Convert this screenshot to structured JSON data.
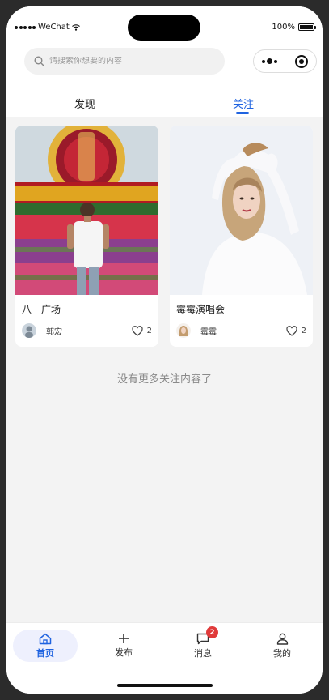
{
  "status_bar": {
    "carrier": "WeChat",
    "battery_text": "100%"
  },
  "search": {
    "placeholder": "请搜索你想要的内容"
  },
  "tabs": [
    {
      "label": "发现",
      "active": false
    },
    {
      "label": "关注",
      "active": true
    }
  ],
  "posts": [
    {
      "title": "八一广场",
      "author": "郭宏",
      "likes": "2",
      "image": "person-standing-before-chinese-knot-flower-display",
      "avatar": "gray-avatar-image"
    },
    {
      "title": "霉霉演唱会",
      "author": "霉霉",
      "likes": "2",
      "image": "blonde-woman-in-white-sweater-portrait",
      "avatar": "blonde-woman-avatar-image"
    }
  ],
  "empty_message": "没有更多关注内容了",
  "tabbar": {
    "items": [
      {
        "label": "首页",
        "icon": "home-icon",
        "active": true
      },
      {
        "label": "发布",
        "icon": "plus-icon",
        "active": false
      },
      {
        "label": "消息",
        "icon": "chat-bubble-icon",
        "active": false,
        "badge": "2"
      },
      {
        "label": "我的",
        "icon": "user-icon",
        "active": false
      }
    ]
  },
  "colors": {
    "accent": "#1f63e0",
    "badge": "#e03a3a",
    "page_background": "#f3f3f3"
  }
}
